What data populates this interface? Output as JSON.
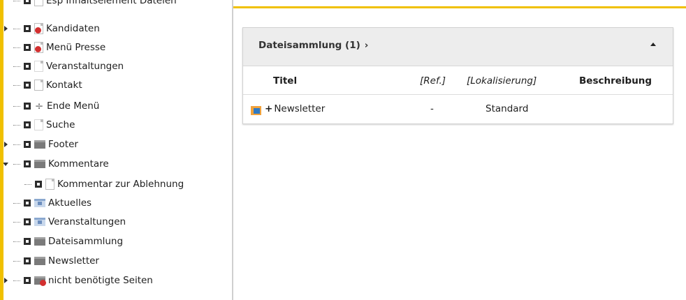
{
  "tree": {
    "items": [
      {
        "label": "Esp Inhaltselement Dateien",
        "icon": "page-icon"
      },
      {
        "label": "Kandidaten",
        "icon": "page-restricted-icon"
      },
      {
        "label": "Menü Presse",
        "icon": "page-restricted-icon"
      },
      {
        "label": "Veranstaltungen",
        "icon": "page-icon"
      },
      {
        "label": "Kontakt",
        "icon": "page-icon"
      },
      {
        "label": "Ende Menü",
        "icon": "divider-icon"
      },
      {
        "label": "Suche",
        "icon": "page-icon"
      },
      {
        "label": "Footer",
        "icon": "folder-icon"
      },
      {
        "label": "Kommentare",
        "icon": "folder-icon"
      },
      {
        "label": "Kommentar zur Ablehnung",
        "icon": "page-icon"
      },
      {
        "label": "Aktuelles",
        "icon": "news-folder-icon"
      },
      {
        "label": "Veranstaltungen",
        "icon": "news-folder-icon"
      },
      {
        "label": "Dateisammlung",
        "icon": "folder-icon"
      },
      {
        "label": "Newsletter",
        "icon": "folder-icon"
      },
      {
        "label": "nicht benötigte Seiten",
        "icon": "folder-restricted-icon"
      }
    ]
  },
  "panel": {
    "title": "Dateisammlung (1)",
    "chevron": "›",
    "columns": [
      "Titel",
      "[Ref.]",
      "[Lokalisierung]",
      "Beschreibung"
    ],
    "rows": [
      {
        "title": "Newsletter",
        "ref": "-",
        "localization": "Standard",
        "description": ""
      }
    ]
  },
  "colors": {
    "accent": "#f0c000",
    "panel_header": "#ededed"
  }
}
